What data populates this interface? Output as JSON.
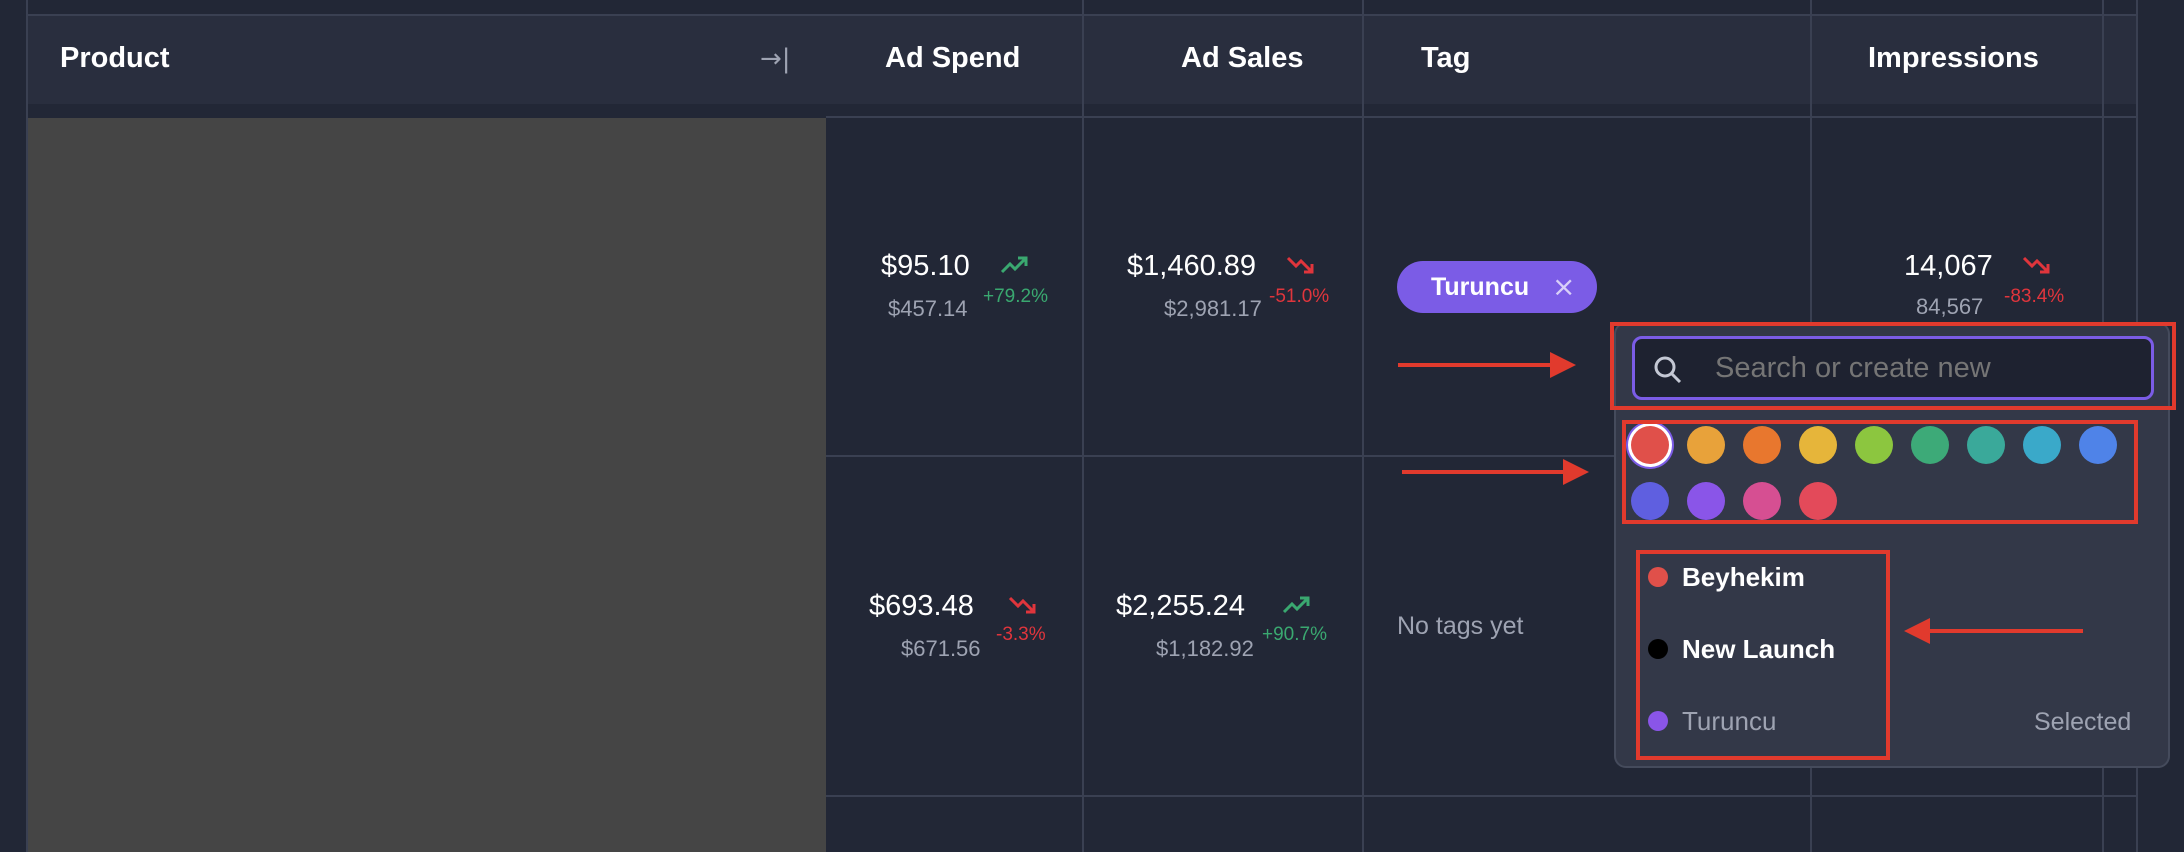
{
  "header": {
    "product": "Product",
    "collapse_icon": "→|",
    "ad_spend": "Ad Spend",
    "ad_sales": "Ad Sales",
    "tag": "Tag",
    "impressions": "Impressions"
  },
  "rows": [
    {
      "ad_spend": {
        "value": "$95.10",
        "prev": "$457.14",
        "change": "+79.2%",
        "trend": "up"
      },
      "ad_sales": {
        "value": "$1,460.89",
        "prev": "$2,981.17",
        "change": "-51.0%",
        "trend": "down"
      },
      "tag": {
        "label": "Turuncu",
        "remove_icon": "×"
      },
      "impressions": {
        "value": "14,067",
        "prev": "84,567",
        "change": "-83.4%",
        "trend": "down"
      }
    },
    {
      "ad_spend": {
        "value": "$693.48",
        "prev": "$671.56",
        "change": "-3.3%",
        "trend": "down"
      },
      "ad_sales": {
        "value": "$2,255.24",
        "prev": "$1,182.92",
        "change": "+90.7%",
        "trend": "up"
      },
      "tag": {
        "empty": "No tags yet"
      }
    }
  ],
  "tag_popover": {
    "search_placeholder": "Search or create new",
    "colors": [
      "#e0504a",
      "#e8a23a",
      "#e8772e",
      "#e6b53a",
      "#8cc63f",
      "#3daa78",
      "#3aa99a",
      "#3aa9c9",
      "#4f83e8",
      "#5f5fe0",
      "#8a55e8",
      "#d64f92",
      "#e34a5a"
    ],
    "options": [
      {
        "label": "Beyhekim",
        "color": "#e0504a"
      },
      {
        "label": "New Launch",
        "color": "#000000"
      },
      {
        "label": "Turuncu",
        "color": "#8a55e8",
        "status": "Selected"
      }
    ]
  },
  "accent": "#7b5ce6"
}
